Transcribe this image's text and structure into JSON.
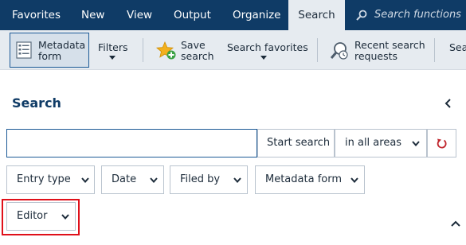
{
  "menubar": {
    "items": [
      {
        "label": "Favorites",
        "active": false
      },
      {
        "label": "New",
        "active": false
      },
      {
        "label": "View",
        "active": false
      },
      {
        "label": "Output",
        "active": false
      },
      {
        "label": "Organize",
        "active": false
      },
      {
        "label": "Search",
        "active": true
      }
    ],
    "search_functions_placeholder": "Search functions"
  },
  "ribbon": {
    "metadata_form": {
      "line1": "Metadata",
      "line2": "form"
    },
    "filters": "Filters",
    "save_search": {
      "line1": "Save",
      "line2": "search"
    },
    "search_favorites": "Search favorites",
    "recent_search": {
      "line1": "Recent search",
      "line2": "requests"
    },
    "truncated": "Sea"
  },
  "panel": {
    "title": "Search",
    "search_input_value": "",
    "start_search_label": "Start search",
    "scope_label": "in all areas",
    "filters": [
      {
        "label": "Entry type"
      },
      {
        "label": "Date"
      },
      {
        "label": "Filed by"
      },
      {
        "label": "Metadata form"
      },
      {
        "label": "Editor"
      }
    ]
  },
  "colors": {
    "menubar_bg": "#0f3b66",
    "ribbon_bg": "#e6ebf0",
    "accent": "#1c5a96",
    "highlight": "#e0101a",
    "reset_icon": "#c0262d"
  }
}
